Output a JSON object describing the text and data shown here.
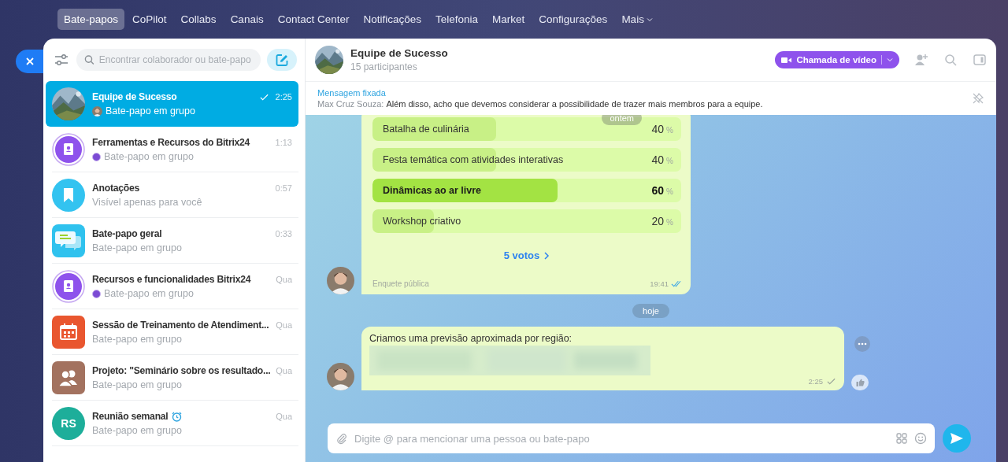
{
  "nav": {
    "items": [
      {
        "label": "Bate-papos",
        "selected": true
      },
      {
        "label": "CoPilot",
        "selected": false
      },
      {
        "label": "Collabs",
        "selected": false
      },
      {
        "label": "Canais",
        "selected": false
      },
      {
        "label": "Contact Center",
        "selected": false
      },
      {
        "label": "Notificações",
        "selected": false
      },
      {
        "label": "Telefonia",
        "selected": false
      },
      {
        "label": "Market",
        "selected": false
      },
      {
        "label": "Configurações",
        "selected": false
      }
    ],
    "more": "Mais"
  },
  "sidebar": {
    "search": {
      "placeholder": "Encontrar colaborador ou bate-papo"
    },
    "chats": [
      {
        "title": "Equipe de Sucesso",
        "subtitle": "Bate-papo em grupo",
        "time": "2:25",
        "read": true,
        "timer": false,
        "selected": true
      },
      {
        "title": "Ferramentas e Recursos do Bitrix24",
        "subtitle": "Bate-papo em grupo",
        "time": "1:13",
        "avatar": {
          "kind": "book"
        },
        "badge": {
          "kind": "dot"
        },
        "read": false,
        "timer": false,
        "selected": false
      },
      {
        "title": "Anotações",
        "subtitle": "Visível apenas para você",
        "time": "0:57",
        "avatar": {
          "kind": "bookmark"
        },
        "read": false,
        "timer": false,
        "selected": false
      },
      {
        "title": "Bate-papo geral",
        "subtitle": "Bate-papo em grupo",
        "time": "0:33",
        "avatar": {
          "kind": "bubbles"
        },
        "read": false,
        "timer": false,
        "selected": false
      },
      {
        "title": "Recursos e funcionalidades Bitrix24",
        "subtitle": "Bate-papo em grupo",
        "time": "Qua",
        "avatar": {
          "kind": "book"
        },
        "badge": {
          "kind": "dot"
        },
        "read": false,
        "timer": false,
        "selected": false
      },
      {
        "title": "Sessão de Treinamento de Atendiment...",
        "subtitle": "Bate-papo em grupo",
        "time": "Qua",
        "avatar": {
          "kind": "calendar"
        },
        "read": false,
        "timer": false,
        "selected": false
      },
      {
        "title": "Projeto: \"Seminário sobre os resultado...",
        "subtitle": "Bate-papo em grupo",
        "time": "Qua",
        "avatar": {
          "kind": "group"
        },
        "read": false,
        "timer": false,
        "selected": false
      },
      {
        "title": "Reunião semanal",
        "subtitle": "Bate-papo em grupo",
        "time": "Qua",
        "avatar": {
          "kind": "initials",
          "text": "RS"
        },
        "read": false,
        "timer": true,
        "selected": false
      }
    ]
  },
  "chat": {
    "title": "Equipe de Sucesso",
    "subtitle": "15 participantes",
    "call_button": "Chamada de vídeo",
    "pinned": {
      "label": "Mensagem fixada",
      "author": "Max Cruz Souza:",
      "text": "Além disso, acho que devemos considerar a possibilidade de trazer mais membros para a equipe."
    },
    "poll": {
      "date_chip": "ontem",
      "options": [
        {
          "label": "Batalha de culinária",
          "value": "40",
          "unit": "%",
          "level": 0.4,
          "top": false
        },
        {
          "label": "Festa temática com atividades interativas",
          "value": "40",
          "unit": "%",
          "level": 0.4,
          "top": false
        },
        {
          "label": "Dinâmicas ao ar livre",
          "value": "60",
          "unit": "%",
          "level": 0.6,
          "top": true
        },
        {
          "label": "Workshop criativo",
          "value": "20",
          "unit": "%",
          "level": 0.2,
          "top": false
        }
      ],
      "votes": "5 votos",
      "footer": "Enquete pública",
      "time": "19:41",
      "read": true
    },
    "day_chip": "hoje",
    "message": {
      "text": "Criamos uma previsão aproximada por região:",
      "time": "2:25",
      "read": true
    },
    "composer": {
      "placeholder": "Digite @ para mencionar uma pessoa ou bate-papo"
    }
  }
}
